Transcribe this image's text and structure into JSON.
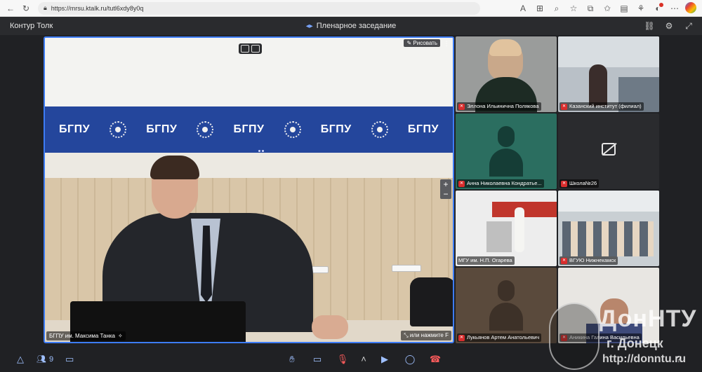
{
  "browser": {
    "url": "https://mrsu.ktalk.ru/tutl6xdy8y0q"
  },
  "app": {
    "name": "Контур Толк",
    "meeting_title": "Пленарное заседание"
  },
  "stage": {
    "draw_label": "Рисовать",
    "speaker_name": "БГПУ им. Максима Танка",
    "hint": "или нажмите F",
    "banner_text": [
      "БГПУ",
      "БГПУ",
      "БГПУ",
      "БГПУ",
      "БГПУ"
    ]
  },
  "tiles": [
    {
      "name": "Эллона Ильинична Полякова",
      "mic_off": true
    },
    {
      "name": "Казанский институт (филиал)",
      "mic_off": true
    },
    {
      "name": "Анна Николаевна Кондратье...",
      "mic_off": true
    },
    {
      "name": "Школа№26",
      "mic_off": true
    },
    {
      "name": "МГУ им. Н.П. Огарева",
      "mic_off": false
    },
    {
      "name": "ВГУЮ Нижнекамск",
      "mic_off": true
    },
    {
      "name": "Лукьянов Артем Анатольевич",
      "mic_off": true
    },
    {
      "name": "Аникина Галина Васильевна",
      "mic_off": true
    }
  ],
  "toolbar": {
    "participants_count": "9"
  },
  "watermark": {
    "line1": "ДонНТУ",
    "line2": "г. Донецк",
    "line3": "http://donntu.ru"
  },
  "icons": {
    "chrome": [
      "back-icon",
      "refresh-icon",
      "lock-icon",
      "star-icon",
      "tab-icon",
      "extensions-icon",
      "profile-icon",
      "more-icon"
    ],
    "header": [
      "link-icon",
      "settings-icon",
      "fullscreen-icon"
    ],
    "bottom": [
      "apps-icon",
      "people-icon",
      "chat-icon",
      "hand-icon",
      "screen-share-icon",
      "mic-off-icon",
      "chevron-up-icon",
      "camera-icon",
      "record-icon",
      "hangup-icon",
      "help-icon"
    ]
  }
}
